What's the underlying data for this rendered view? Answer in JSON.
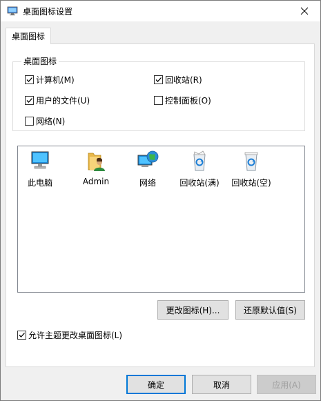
{
  "window": {
    "title": "桌面图标设置",
    "title_icon": "display-settings-icon",
    "close_icon": "close-icon"
  },
  "tabs": [
    {
      "label": "桌面图标"
    }
  ],
  "group": {
    "label": "桌面图标",
    "checkboxes": [
      {
        "label": "计算机(M)",
        "checked": true
      },
      {
        "label": "回收站(R)",
        "checked": true
      },
      {
        "label": "用户的文件(U)",
        "checked": true
      },
      {
        "label": "控制面板(O)",
        "checked": false
      },
      {
        "label": "网络(N)",
        "checked": false
      }
    ]
  },
  "icons": [
    {
      "label": "此电脑",
      "icon": "computer-icon"
    },
    {
      "label": "Admin",
      "icon": "user-folder-icon"
    },
    {
      "label": "网络",
      "icon": "network-icon"
    },
    {
      "label": "回收站(满)",
      "icon": "recycle-bin-full-icon"
    },
    {
      "label": "回收站(空)",
      "icon": "recycle-bin-empty-icon"
    }
  ],
  "buttons": {
    "change_icon": "更改图标(H)...",
    "restore_default": "还原默认值(S)",
    "ok": "确定",
    "cancel": "取消",
    "apply": "应用(A)"
  },
  "allow_themes": {
    "label": "允许主题更改桌面图标(L)",
    "checked": true
  }
}
